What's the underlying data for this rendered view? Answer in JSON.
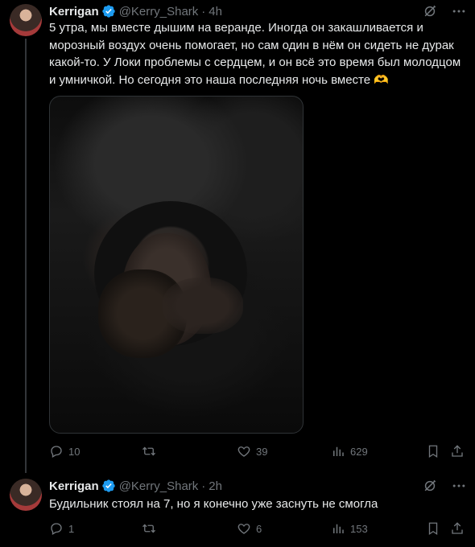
{
  "tweets": [
    {
      "author": "Kerrigan",
      "handle": "@Kerry_Shark",
      "separator": "·",
      "time": "4h",
      "text": "5 утра, мы вместе дышим на веранде. Иногда он закашливается и морозный воздух очень помогает, но сам один в нём он сидеть не дурак какой-то. У Локи проблемы с сердцем, и он всё это время был молодцом и умничкой. Но сегодня это наша последняя ночь вместе 🫶",
      "replies": "10",
      "retweets": "",
      "likes": "39",
      "views": "629"
    },
    {
      "author": "Kerrigan",
      "handle": "@Kerry_Shark",
      "separator": "·",
      "time": "2h",
      "text": "Будильник стоял на 7, но я конечно уже заснуть не смогла",
      "replies": "1",
      "retweets": "",
      "likes": "6",
      "views": "153"
    }
  ],
  "colors": {
    "background": "#000000",
    "text": "#e7e9ea",
    "muted": "#71767b",
    "verified": "#1d9bf0",
    "thread_line": "#333639"
  }
}
